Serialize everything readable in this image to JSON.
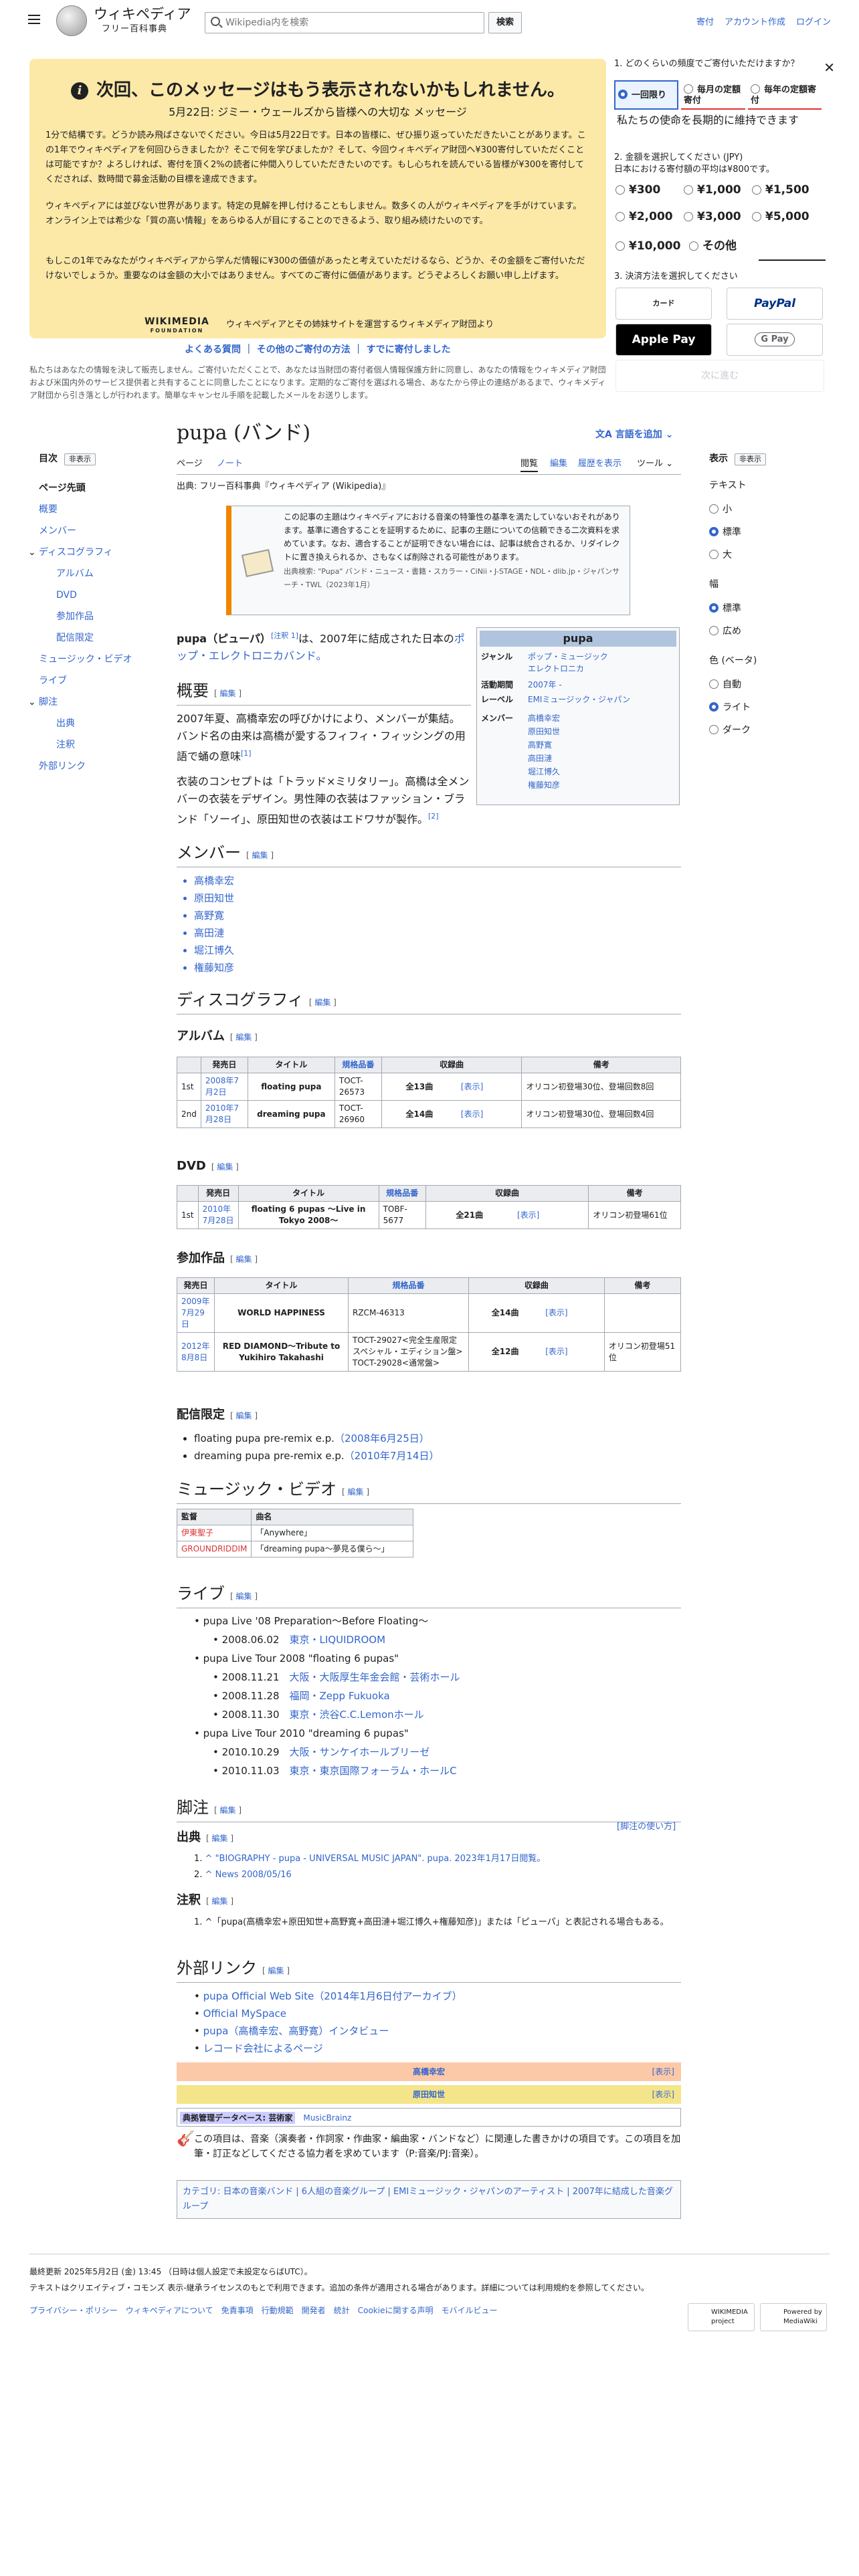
{
  "header": {
    "wiki_name": "ウィキペディア",
    "wiki_tagline": "フリー百科事典",
    "search_placeholder": "Wikipedia内を検索",
    "search_button": "検索",
    "user_links": [
      "寄付",
      "アカウント作成",
      "ログイン"
    ]
  },
  "banner": {
    "title": "次回、このメッセージはもう表示されないかもしれません。",
    "subtitle": "5月22日: ジミー・ウェールズから皆様への大切な メッセージ",
    "p1": "1分で結構です。どうか読み飛ばさないでください。今日は5月22日です。日本の皆様に、ぜひ振り返っていただきたいことがあります。この1年でウィキペディアを何回ひらきましたか？そこで何を学びましたか？そして、今回ウィキペディア財団へ¥300寄付していただくことは可能ですか？よろしければ、寄付を頂く2%の読者に仲間入りしていただきたいのです。もし心ちれを読んでいる皆様が¥300を寄付してくだされば、数時間で募金活動の目標を達成できます。",
    "p2": "ウィキペディアには並びない世界があります。特定の見解を押し付けることもしません。数多くの人がウィキペディアを手がけています。オンライン上では希少な「質の高い情報」をあらゆる人が目にすることのできるよう、取り組み続けたいのです。",
    "p3": "もしこの1年でみなたがウィキペディアから学んだ情報に¥300の価値があったと考えていただけるなら、どうか、その金額をご寄付いただけないでしょうか。重要なのは金額の大小ではありません。すべてのご寄付に価値があります。どうぞよろしくお願い申し上げます。",
    "foundation": "WIKIMEDIA",
    "foundation_sub": "FOUNDATION",
    "foundation_text": "ウィキペディアとその姉妹サイトを運営するウィキメディア財団より",
    "links": [
      "よくある質問",
      "その他のご寄付の方法",
      "すでに寄付しました"
    ],
    "privacy": "私たちはあなたの情報を決して販売しません。ご寄付いただくことで、あなたは当財団の寄付者個人情報保護方針に同意し、あなたの情報をウィキメディア財団および米国内外のサービス提供者と共有することに同意したことになります。定期的なご寄付を選ばれる場合、あなたから停止の連絡があるまで、ウィキメディア財団から引き落としが行われます。簡単なキャンセル手順を記載したメールをお送りします。"
  },
  "donate": {
    "q1": "1. どのくらいの頻度でご寄付いただけますか？",
    "freq": [
      "一回限り",
      "毎月の定額寄付",
      "毎年の定額寄付"
    ],
    "notice": "私たちの使命を長期的に維持できます",
    "q2": "2. 金額を選択してください (JPY)",
    "q2b": "日本における寄付額の平均は¥800です。",
    "amounts": [
      "¥300",
      "¥1,000",
      "¥1,500",
      "¥2,000",
      "¥3,000",
      "¥5,000",
      "¥10,000",
      "その他"
    ],
    "q3": "3. 決済方法を選択してください",
    "pay": [
      "カード",
      "PayPal",
      "Apple Pay",
      "G Pay"
    ],
    "submit": "次に進む"
  },
  "toc": {
    "title": "目次",
    "hide": "非表示",
    "items": [
      "ページ先頭",
      "概要",
      "メンバー",
      "ディスコグラフィ",
      "アルバム",
      "DVD",
      "参加作品",
      "配信限定",
      "ミュージック・ビデオ",
      "ライブ",
      "脚注",
      "出典",
      "注釈",
      "外部リンク"
    ]
  },
  "right": {
    "title": "表示",
    "hide": "非表示",
    "text": "テキスト",
    "sizes": [
      "小",
      "標準",
      "大"
    ],
    "width": "幅",
    "widths": [
      "標準",
      "広め"
    ],
    "color": "色 (ベータ)",
    "colors": [
      "自動",
      "ライト",
      "ダーク"
    ]
  },
  "page": {
    "title": "pupa (バンド)",
    "langs": "言語を追加",
    "tabs_left": [
      "ページ",
      "ノート"
    ],
    "tabs_right": [
      "閲覧",
      "編集",
      "履歴を表示",
      "ツール"
    ],
    "from": "出典: フリー百科事典『ウィキペディア (Wikipedia)』"
  },
  "ambox": {
    "text": "この記事の主題はウィキペディアにおける音楽の特筆性の基準を満たしていないおそれがあります。基準に適合することを証明するために、記事の主題についての信頼できる二次資料を求めています。なお、適合することが証明できない場合には、記事は統合されるか、リダイレクトに置き換えられるか、さもなくば削除される可能性があります。",
    "sub": "出典検索: \"Pupa\" バンド・ニュース・書籍・スカラー・CiNii・J-STAGE・NDL・dlib.jp・ジャパンサーチ・TWL（2023年1月）"
  },
  "infobox": {
    "title": "pupa",
    "rows": [
      {
        "k": "ジャンル",
        "v": [
          "ポップ・ミュージック",
          "エレクトロニカ"
        ]
      },
      {
        "k": "活動期間",
        "v": [
          "2007年 -"
        ]
      },
      {
        "k": "レーベル",
        "v": [
          "EMIミュージック・ジャパン"
        ]
      },
      {
        "k": "メンバー",
        "v": [
          "高橋幸宏",
          "原田知世",
          "高野寛",
          "高田漣",
          "堀江博久",
          "権藤知彦"
        ]
      }
    ]
  },
  "lead": {
    "a": "pupa（ピューパ）",
    "b": "[注釈 1]",
    "c": "は、2007年に結成された日本の",
    "d": "ポップ・エレクトロニカバンド。"
  },
  "sec": {
    "overview": "概要",
    "members": "メンバー",
    "disco": "ディスコグラフィ",
    "album": "アルバム",
    "dvd": "DVD",
    "part": "参加作品",
    "digital": "配信限定",
    "mv": "ミュージック・ビデオ",
    "live": "ライブ",
    "notes": "脚注",
    "sources": "出典",
    "annot": "注釈",
    "ext": "外部リンク",
    "edit": "編集",
    "usage": "[脚注の使い方]"
  },
  "overview": {
    "p1": "2007年夏、高橋幸宏の呼びかけにより、メンバーが集結。バンド名の由来は高橋が愛するフィフィ・フィッシングの用語で蛹の意味",
    "p1r": "[1]",
    "p2": "衣装のコンセプトは「トラッド×ミリタリー」。高橋は全メンバーの衣装をデザイン。男性陣の衣装はファッション・ブランド「ソーイ」、原田知世の衣装はエドワサが製作。",
    "p2r": "[2]"
  },
  "members": [
    "高橋幸宏",
    "原田知世",
    "高野寛",
    "高田漣",
    "堀江博久",
    "権藤知彦"
  ],
  "album": {
    "headers": [
      "",
      "発売日",
      "タイトル",
      "規格品番",
      "収録曲",
      "",
      "備考"
    ],
    "rows": [
      [
        "1st",
        "2008年7月2日",
        "floating pupa",
        "TOCT-26573",
        "全13曲",
        "[表示]",
        "オリコン初登場30位、登場回数8回"
      ],
      [
        "2nd",
        "2010年7月28日",
        "dreaming pupa",
        "TOCT-26960",
        "全14曲",
        "[表示]",
        "オリコン初登場30位、登場回数4回"
      ]
    ]
  },
  "dvd": {
    "headers": [
      "",
      "発売日",
      "タイトル",
      "規格品番",
      "収録曲",
      "",
      "備考"
    ],
    "rows": [
      [
        "1st",
        "2010年7月28日",
        "floating 6 pupas ～Live in Tokyo 2008～",
        "TOBF-5677",
        "全21曲",
        "[表示]",
        "オリコン初登場61位"
      ]
    ]
  },
  "part": {
    "headers": [
      "発売日",
      "タイトル",
      "規格品番",
      "収録曲",
      "",
      "備考"
    ],
    "rows": [
      [
        "2009年7月29日",
        "WORLD HAPPINESS",
        "RZCM-46313",
        "全14曲",
        "[表示]",
        ""
      ],
      [
        "2012年8月8日",
        "RED DIAMOND～Tribute to Yukihiro Takahashi",
        "TOCT-29027<完全生産限定スペシャル・エディション盤> TOCT-29028<通常盤>",
        "全12曲",
        "[表示]",
        "オリコン初登場51位"
      ]
    ]
  },
  "digital": [
    {
      "t": "floating pupa pre-remix e.p.",
      "d": "（2008年6月25日）"
    },
    {
      "t": "dreaming pupa pre-remix e.p.",
      "d": "（2010年7月14日）"
    }
  ],
  "mv": {
    "headers": [
      "監督",
      "曲名"
    ],
    "rows": [
      [
        "伊東聖子",
        "「Anywhere」"
      ],
      [
        "GROUNDRIDDIM",
        "「dreaming pupa〜夢見る僕ら〜」"
      ]
    ]
  },
  "live": [
    {
      "t": "pupa Live '08 Preparation～Before Floating～",
      "d": [
        [
          "2008.06.02",
          "東京・LIQUIDROOM"
        ]
      ]
    },
    {
      "t": "pupa Live Tour 2008 \"floating 6 pupas\"",
      "d": [
        [
          "2008.11.21",
          "大阪・大阪厚生年金会館・芸術ホール"
        ],
        [
          "2008.11.28",
          "福岡・Zepp Fukuoka"
        ],
        [
          "2008.11.30",
          "東京・渋谷C.C.Lemonホール"
        ]
      ]
    },
    {
      "t": "pupa Live Tour 2010 \"dreaming 6 pupas\"",
      "d": [
        [
          "2010.10.29",
          "大阪・サンケイホールブリーゼ"
        ],
        [
          "2010.11.03",
          "東京・東京国際フォーラム・ホールC"
        ]
      ]
    }
  ],
  "refs": [
    "^ \"BIOGRAPHY - pupa - UNIVERSAL MUSIC JAPAN\". pupa. 2023年1月17日閲覧。",
    "^ News 2008/05/16"
  ],
  "annot": "^「pupa(高橋幸宏+原田知世+高野寛+高田漣+堀江博久+権藤知彦)」または「ピューパ」と表記される場合もある。",
  "ext": [
    "pupa Official Web Site（2014年1月6日付アーカイブ）",
    "Official MySpace",
    "pupa（高橋幸宏、高野寛）インタビュー",
    "レコード会社によるページ"
  ],
  "navbox": [
    {
      "t": "高橋幸宏",
      "s": "[表示]"
    },
    {
      "t": "原田知世",
      "s": "[表示]"
    }
  ],
  "authority": {
    "label": "典拠管理データベース: 芸術家",
    "v": "MusicBrainz"
  },
  "stub": "この項目は、音楽（演奏者・作詞家・作曲家・編曲家・バンドなど）に関連した書きかけの項目です。この項目を加筆・訂正などしてくださる協力者を求めています（P:音楽/PJ:音楽）。",
  "cats": "カテゴリ: 日本の音楽バンド | 6人組の音楽グループ | EMIミュージック・ジャパンのアーティスト | 2007年に結成した音楽グループ",
  "footer": {
    "updated": "最終更新 2025年5月2日 (金) 13:45 （日時は個人設定で未設定ならばUTC）。",
    "license": "テキストはクリエイティブ・コモンズ 表示-継承ライセンスのもとで利用できます。追加の条件が適用される場合があります。詳細については利用規約を参照してください。",
    "links": [
      "プライバシー・ポリシー",
      "ウィキペディアについて",
      "免責事項",
      "行動規範",
      "開発者",
      "統計",
      "Cookieに関する声明",
      "モバイルビュー"
    ],
    "b1": "WIKIMEDIA project",
    "b2": "Powered by MediaWiki"
  }
}
